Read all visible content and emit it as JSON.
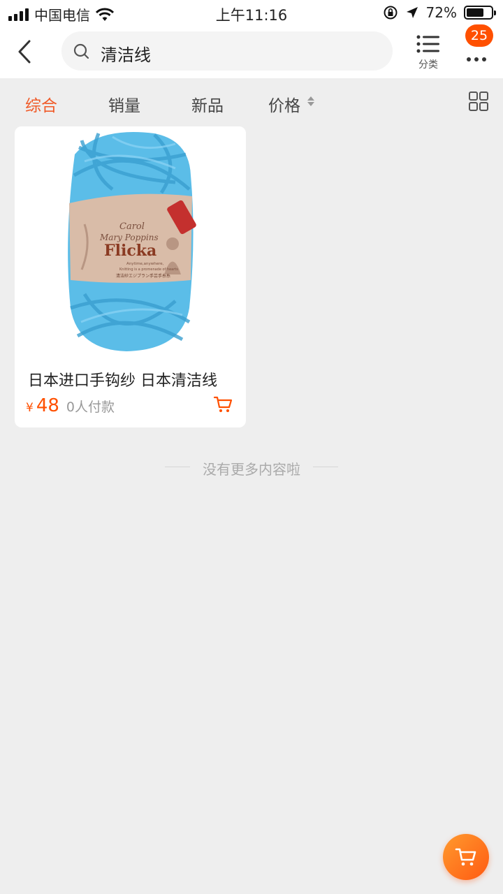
{
  "status_bar": {
    "carrier": "中国电信",
    "time": "上午11:16",
    "battery": "72%",
    "battery_level": 0.72
  },
  "nav": {
    "search_query": "清洁线",
    "category_label": "分类",
    "badge_count": "25"
  },
  "sort_bar": {
    "tabs": [
      "综合",
      "销量",
      "新品",
      "价格"
    ],
    "active_tab": "综合"
  },
  "product": {
    "title": "日本进口手钩纱 日本清洁线",
    "currency": "¥",
    "price": "48",
    "sales": "0人付款",
    "label": {
      "line1": "Carol",
      "line2": "Mary Poppins",
      "brand": "Flicka",
      "tagline1": "Anytime,anywhere,",
      "tagline2": "Knitting is a promenade of hearts",
      "jp_text": "清洁紗エジプラン手芸手糸糸"
    }
  },
  "end_of_list": "没有更多内容啦",
  "colors": {
    "accent": "#ff5000",
    "active_tab": "#f05a28",
    "yarn": "#5bbde8",
    "label": "#d9bca8"
  }
}
